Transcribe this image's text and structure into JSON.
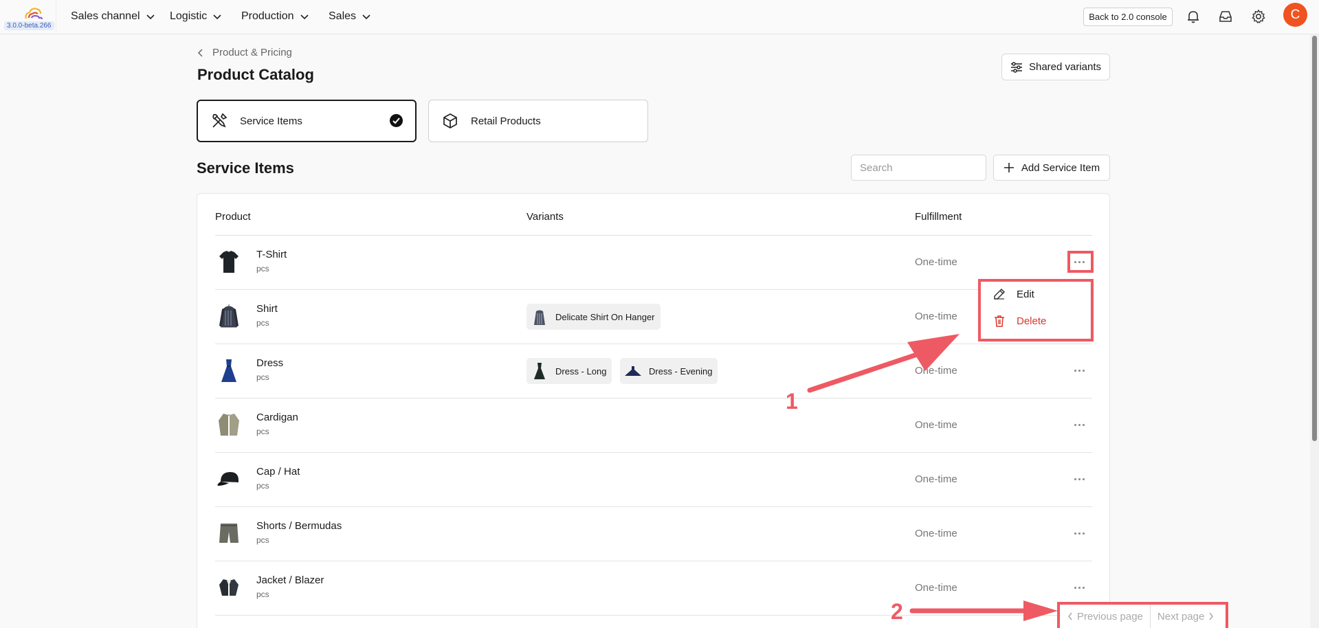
{
  "app": {
    "version": "3.0.0-beta.266",
    "avatar_initial": "C",
    "back_console": "Back to 2.0 console"
  },
  "nav": {
    "items": [
      {
        "label": "Sales channel"
      },
      {
        "label": "Logistic"
      },
      {
        "label": "Production"
      },
      {
        "label": "Sales"
      }
    ]
  },
  "header": {
    "breadcrumb": "Product & Pricing",
    "title": "Product Catalog",
    "shared_variants": "Shared variants"
  },
  "types": [
    {
      "label": "Service Items",
      "selected": true,
      "icon": "tools-icon"
    },
    {
      "label": "Retail Products",
      "selected": false,
      "icon": "box-icon"
    }
  ],
  "section": {
    "title": "Service Items",
    "search_placeholder": "Search",
    "add_label": "Add Service Item"
  },
  "table": {
    "headers": [
      "Product",
      "Variants",
      "Fulfillment"
    ],
    "rows": [
      {
        "name": "T-Shirt",
        "unit": "pcs",
        "fulfillment": "One-time",
        "variants": []
      },
      {
        "name": "Shirt",
        "unit": "pcs",
        "fulfillment": "One-time",
        "variants": [
          "Delicate Shirt On Hanger"
        ]
      },
      {
        "name": "Dress",
        "unit": "pcs",
        "fulfillment": "One-time",
        "variants": [
          "Dress - Long",
          "Dress - Evening"
        ]
      },
      {
        "name": "Cardigan",
        "unit": "pcs",
        "fulfillment": "One-time",
        "variants": []
      },
      {
        "name": "Cap / Hat",
        "unit": "pcs",
        "fulfillment": "One-time",
        "variants": []
      },
      {
        "name": "Shorts / Bermudas",
        "unit": "pcs",
        "fulfillment": "One-time",
        "variants": []
      },
      {
        "name": "Jacket / Blazer",
        "unit": "pcs",
        "fulfillment": "One-time",
        "variants": []
      }
    ]
  },
  "menu": {
    "edit": "Edit",
    "delete": "Delete"
  },
  "annotations": {
    "one": "1",
    "two": "2",
    "color": "#ee5a63"
  },
  "pagination": {
    "previous": "Previous page",
    "next": "Next page"
  }
}
